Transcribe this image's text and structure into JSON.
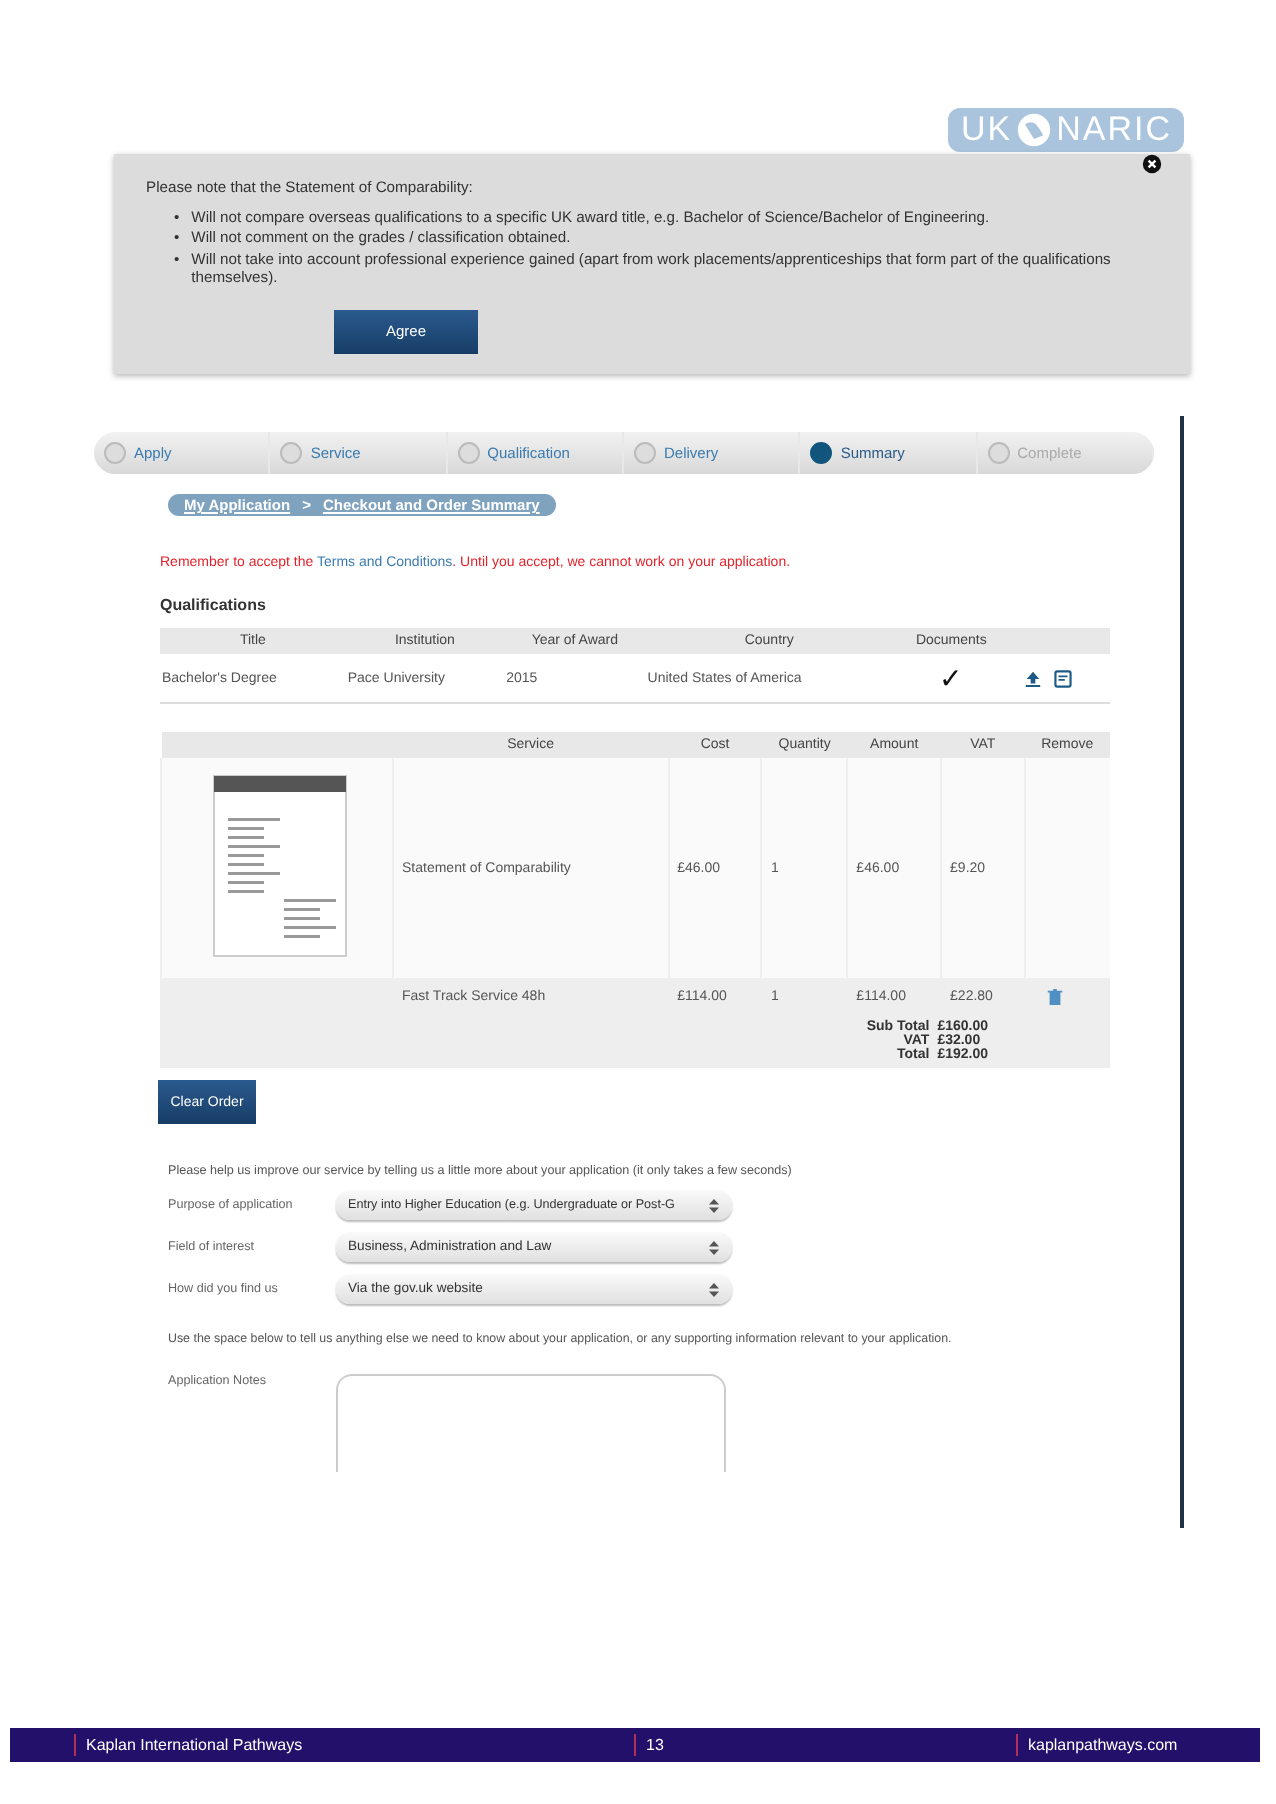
{
  "logo": {
    "left": "UK",
    "right": "NARIC"
  },
  "notice": {
    "intro": "Please note that the Statement of Comparability:",
    "points": [
      {
        "bullet": "•",
        "text": "Will not compare overseas qualifications to a specific UK award title, e.g. Bachelor of Science/Bachelor of Engineering."
      },
      {
        "bullet": "•",
        "text": "Will not comment on the grades / classification obtained."
      },
      {
        "bullet": "•",
        "text": "Will not take into account professional experience gained (apart from work placements/apprenticeships that form part of the qualifications themselves)."
      }
    ],
    "button": "Agree"
  },
  "steps": [
    {
      "label": "Apply",
      "selected": false,
      "disabled": false
    },
    {
      "label": "Service",
      "selected": false,
      "disabled": false
    },
    {
      "label": "Qualification",
      "selected": false,
      "disabled": false
    },
    {
      "label": "Delivery",
      "selected": false,
      "disabled": false
    },
    {
      "label": "Summary",
      "selected": true,
      "disabled": false
    },
    {
      "label": "Complete",
      "selected": false,
      "disabled": true
    }
  ],
  "breadcrumb": [
    "My Application",
    ">",
    "Checkout and Order Summary"
  ],
  "warning": {
    "before": "Remember to accept the ",
    "link": "Terms and Conditions",
    "after": ". Until you accept, we cannot work on your application."
  },
  "qualifications": {
    "heading": "Qualifications",
    "columns": [
      "Title",
      "Institution",
      "Year of Award",
      "Country",
      "Documents"
    ],
    "rows": [
      {
        "cells": [
          "Bachelor's Degree",
          "Pace University",
          "2015",
          "United States of America"
        ],
        "documents": "✓"
      }
    ]
  },
  "services": {
    "columns": [
      "Service",
      "Cost",
      "Quantity",
      "Amount",
      "VAT",
      "Remove"
    ],
    "rows": [
      {
        "thumbnail": true,
        "removable": false,
        "cells": [
          "Statement of Comparability",
          "£46.00",
          "1",
          "£46.00",
          "£9.20"
        ]
      },
      {
        "thumbnail": false,
        "removable": true,
        "cells": [
          "Fast Track Service 48h",
          "£114.00",
          "1",
          "£114.00",
          "£22.80"
        ]
      }
    ],
    "totals": [
      {
        "label": "Sub Total",
        "value": "£160.00"
      },
      {
        "label": "VAT",
        "value": "£32.00"
      },
      {
        "label": "Total",
        "value": "£192.00"
      }
    ]
  },
  "clear_button": "Clear Order",
  "survey_intro": "Please help us improve our service by telling us a little more about your application (it only takes a few seconds)",
  "selects": [
    {
      "label": "Purpose of application",
      "value": "Entry into Higher Education (e.g. Undergraduate or Post-G"
    },
    {
      "label": "Field of interest",
      "value": "Business, Administration and Law"
    },
    {
      "label": "How did you find us",
      "value": "Via the gov.uk website"
    }
  ],
  "notes_intro": "Use the space below to tell us anything else we need to know about your application, or any supporting information relevant to your application.",
  "notes_label": "Application Notes",
  "footer": [
    "Kaplan International Pathways",
    "13",
    "kaplanpathways.com"
  ]
}
